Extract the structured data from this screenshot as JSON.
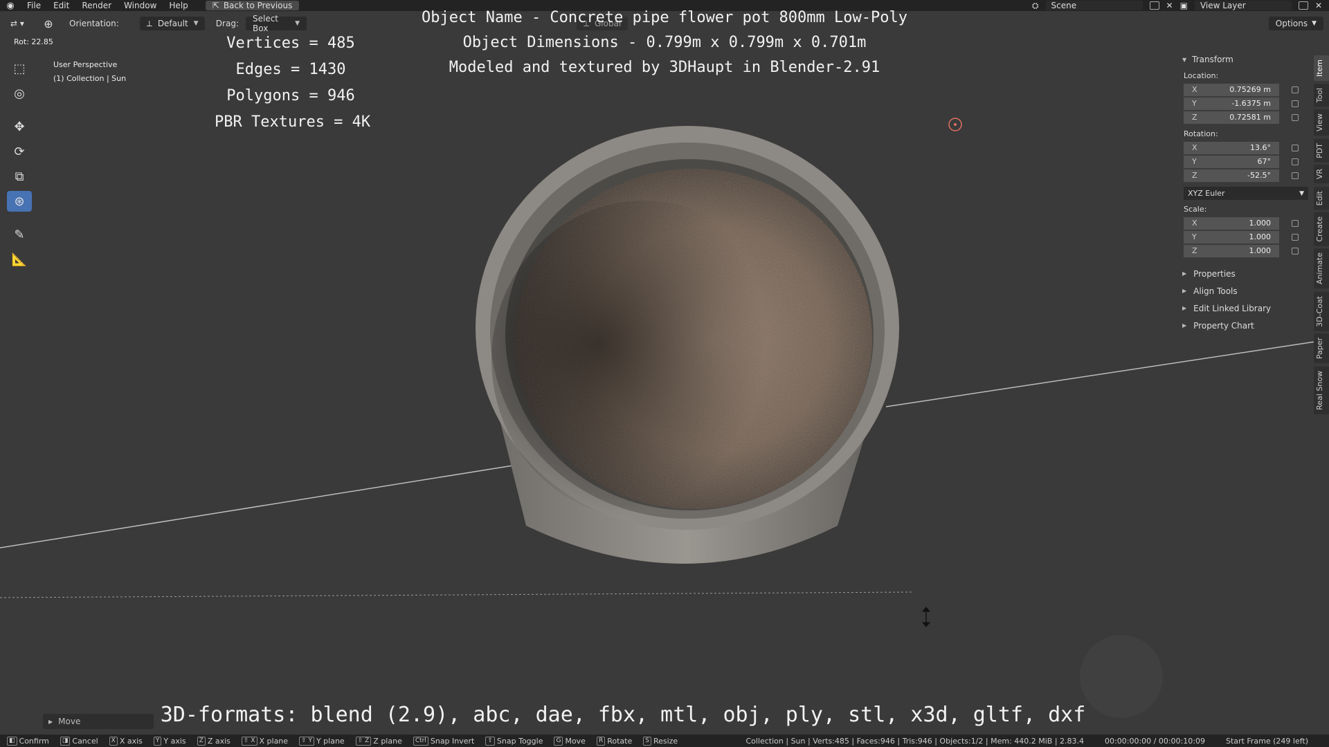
{
  "menu": {
    "items": [
      "File",
      "Edit",
      "Render",
      "Window",
      "Help"
    ],
    "back_button": "Back to Previous",
    "scene": "Scene",
    "view_layer": "View Layer"
  },
  "header": {
    "orientation_label": "Orientation:",
    "orientation_value": "Default",
    "drag_label": "Drag:",
    "drag_value": "Select Box",
    "global_label": "Global",
    "options_label": "Options"
  },
  "rot_readout": "Rot: 22.85",
  "viewport": {
    "perspective": "User Perspective",
    "collection": "(1) Collection | Sun"
  },
  "overlay": {
    "stats": [
      "Vertices = 485",
      "Edges = 1430",
      "Polygons = 946",
      "PBR Textures = 4K"
    ],
    "title_lines": [
      "Object Name - Concrete pipe flower pot 800mm Low-Poly",
      "Object Dimensions -  0.799m x 0.799m x 0.701m",
      "Modeled and textured by 3DHaupt in Blender-2.91"
    ],
    "formats": "3D-formats: blend (2.9), abc, dae, fbx, mtl, obj, ply, stl, x3d, gltf, dxf"
  },
  "transform": {
    "header": "Transform",
    "location_label": "Location:",
    "location": [
      {
        "axis": "X",
        "value": "0.75269 m"
      },
      {
        "axis": "Y",
        "value": "-1.6375 m"
      },
      {
        "axis": "Z",
        "value": "0.72581 m"
      }
    ],
    "rotation_label": "Rotation:",
    "rotation": [
      {
        "axis": "X",
        "value": "13.6°"
      },
      {
        "axis": "Y",
        "value": "67°"
      },
      {
        "axis": "Z",
        "value": "-52.5°"
      }
    ],
    "rotation_mode": "XYZ Euler",
    "scale_label": "Scale:",
    "scale": [
      {
        "axis": "X",
        "value": "1.000"
      },
      {
        "axis": "Y",
        "value": "1.000"
      },
      {
        "axis": "Z",
        "value": "1.000"
      }
    ]
  },
  "panels": [
    "Properties",
    "Align Tools",
    "Edit Linked Library",
    "Property Chart"
  ],
  "vtabs": [
    "Item",
    "Tool",
    "View",
    "PDT",
    "VR",
    "Edit",
    "Create",
    "Animate",
    "3D-Coat",
    "Paper",
    "Real Snow"
  ],
  "move_panel": "Move",
  "statusbar": {
    "items": [
      {
        "key": "",
        "label": "Confirm"
      },
      {
        "key": "",
        "label": "Cancel"
      },
      {
        "key": "X",
        "label": "X axis"
      },
      {
        "key": "Y",
        "label": "Y axis"
      },
      {
        "key": "Z",
        "label": "Z axis"
      },
      {
        "key": "⇧ X",
        "label": "X plane"
      },
      {
        "key": "⇧ Y",
        "label": "Y plane"
      },
      {
        "key": "⇧ Z",
        "label": "Z plane"
      },
      {
        "key": "Ctrl",
        "label": "Snap Invert"
      },
      {
        "key": "⇧",
        "label": "Snap Toggle"
      },
      {
        "key": "G",
        "label": "Move"
      },
      {
        "key": "R",
        "label": "Rotate"
      },
      {
        "key": "S",
        "label": "Resize"
      }
    ],
    "stats": "Collection | Sun | Verts:485 | Faces:946 | Tris:946 | Objects:1/2 | Mem: 440.2 MiB | 2.83.4",
    "time": "00:00:00:00 / 00:00:10:09",
    "frame": "Start Frame (249 left)"
  },
  "colors": {
    "accent": "#4772b3",
    "background": "#3a3a3a",
    "header": "#232323"
  }
}
